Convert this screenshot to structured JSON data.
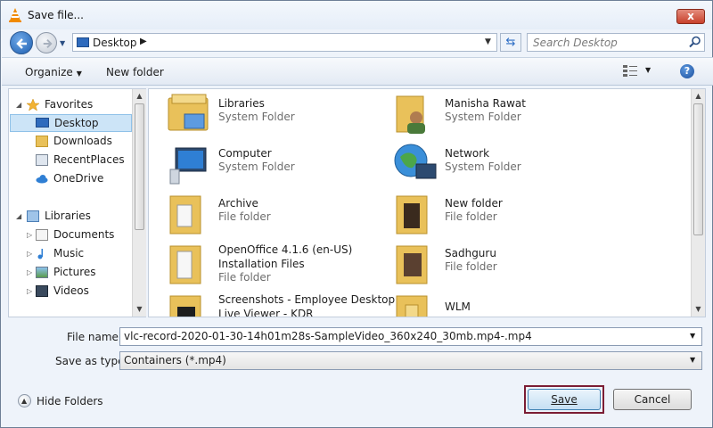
{
  "window": {
    "title": "Save file...",
    "close_label": "x"
  },
  "address": {
    "location": "Desktop",
    "search_placeholder": "Search Desktop"
  },
  "toolbar": {
    "organize_label": "Organize",
    "new_folder_label": "New folder",
    "help_label": "?"
  },
  "nav": {
    "favorites": {
      "label": "Favorites",
      "items": [
        {
          "label": "Desktop",
          "icon": "desktop-icon",
          "selected": true
        },
        {
          "label": "Downloads",
          "icon": "folder-icon"
        },
        {
          "label": "RecentPlaces",
          "icon": "recent-places-icon"
        },
        {
          "label": "OneDrive",
          "icon": "cloud-icon"
        }
      ]
    },
    "libraries": {
      "label": "Libraries",
      "items": [
        {
          "label": "Documents",
          "icon": "documents-icon"
        },
        {
          "label": "Music",
          "icon": "music-icon"
        },
        {
          "label": "Pictures",
          "icon": "pictures-icon"
        },
        {
          "label": "Videos",
          "icon": "videos-icon"
        }
      ]
    }
  },
  "files": [
    {
      "name": "Libraries",
      "type": "System Folder",
      "icon": "libraries-icon"
    },
    {
      "name": "Manisha Rawat",
      "type": "System Folder",
      "icon": "user-folder-icon"
    },
    {
      "name": "Computer",
      "type": "System Folder",
      "icon": "computer-icon"
    },
    {
      "name": "Network",
      "type": "System Folder",
      "icon": "network-icon"
    },
    {
      "name": "Archive",
      "type": "File folder",
      "icon": "folder-icon"
    },
    {
      "name": "New folder",
      "type": "File folder",
      "icon": "folder-icon"
    },
    {
      "name": "OpenOffice 4.1.6 (en-US)",
      "name2": "Installation Files",
      "type": "File folder",
      "icon": "folder-icon"
    },
    {
      "name": "Sadhguru",
      "type": "File folder",
      "icon": "folder-icon"
    },
    {
      "name": "Screenshots - Employee Desktop",
      "name2": "Live Viewer - KDR",
      "type": "",
      "icon": "folder-icon"
    },
    {
      "name": "WLM",
      "type": "",
      "icon": "folder-icon"
    }
  ],
  "fields": {
    "file_name_label": "File name:",
    "file_name_value": "vlc-record-2020-01-30-14h01m28s-SampleVideo_360x240_30mb.mp4-.mp4",
    "save_type_label": "Save as type:",
    "save_type_value": "Containers (*.mp4)"
  },
  "footer": {
    "hide_folders_label": "Hide Folders",
    "save_label": "Save",
    "cancel_label": "Cancel"
  },
  "colors": {
    "accent": "#1e5fb0",
    "save_highlight": "#7b1d34",
    "selection": "#cce4f7"
  }
}
